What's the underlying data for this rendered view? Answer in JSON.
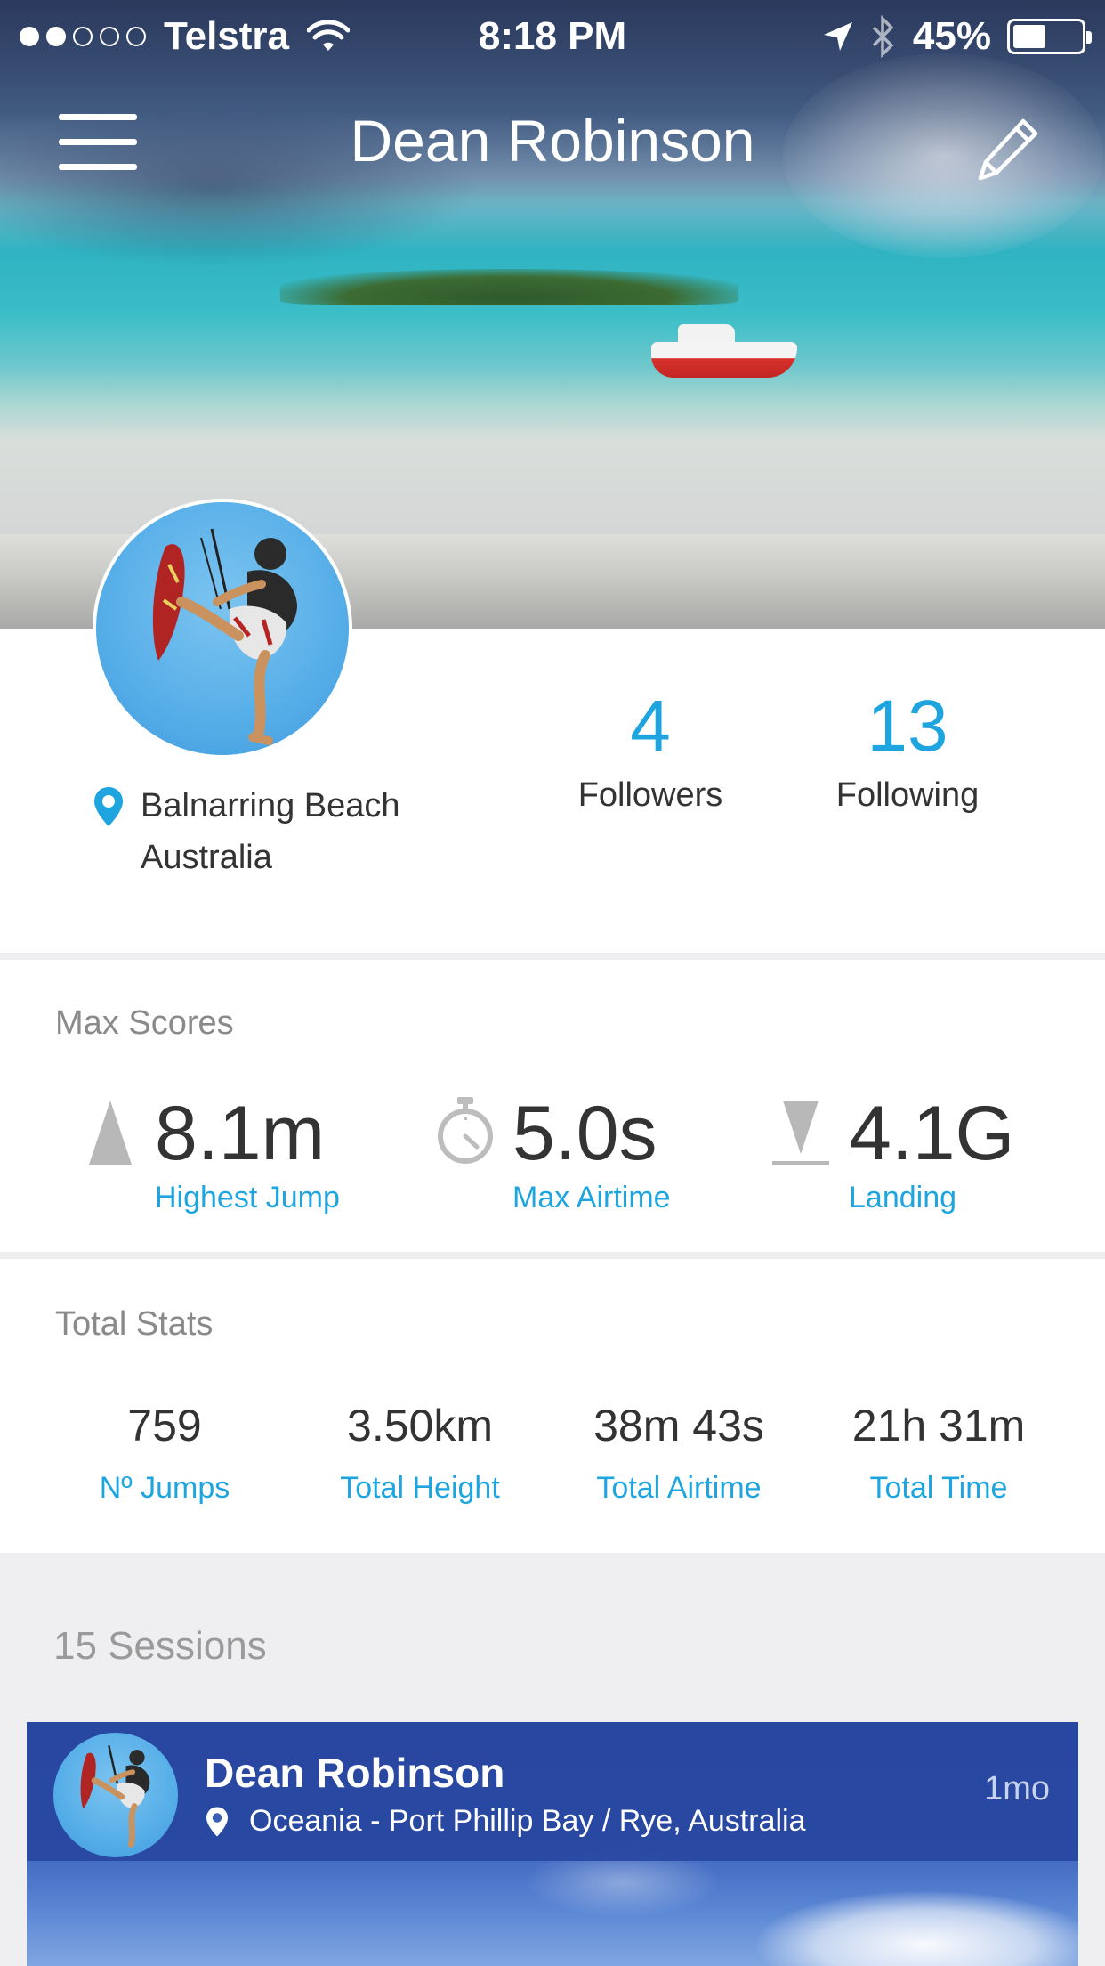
{
  "status_bar": {
    "carrier": "Telstra",
    "time": "8:18 PM",
    "battery": "45%",
    "battery_level": 0.45,
    "signal_bars_filled": 2,
    "signal_bars_total": 5
  },
  "header": {
    "title": "Dean Robinson",
    "menu_icon": "hamburger-menu-icon",
    "edit_icon": "pencil-icon"
  },
  "profile": {
    "location_line1": "Balnarring Beach",
    "location_line2": "Australia",
    "followers_count": "4",
    "followers_label": "Followers",
    "following_count": "13",
    "following_label": "Following"
  },
  "max_scores": {
    "title": "Max Scores",
    "items": [
      {
        "icon": "jump-height-icon",
        "value": "8.1m",
        "label": "Highest Jump"
      },
      {
        "icon": "stopwatch-icon",
        "value": "5.0s",
        "label": "Max Airtime"
      },
      {
        "icon": "landing-icon",
        "value": "4.1G",
        "label": "Landing"
      }
    ]
  },
  "total_stats": {
    "title": "Total Stats",
    "items": [
      {
        "value": "759",
        "label": "Nº Jumps"
      },
      {
        "value": "3.50km",
        "label": "Total Height"
      },
      {
        "value": "38m 43s",
        "label": "Total Airtime"
      },
      {
        "value": "21h 31m",
        "label": "Total Time"
      }
    ]
  },
  "sessions": {
    "title": "15 Sessions",
    "cards": [
      {
        "name": "Dean Robinson",
        "location": "Oceania - Port Phillip Bay / Rye, Australia",
        "ago": "1mo"
      }
    ]
  },
  "colors": {
    "accent": "#1ea5e0",
    "text": "#333333",
    "muted": "#8a8a8a",
    "background": "#efeff1"
  }
}
